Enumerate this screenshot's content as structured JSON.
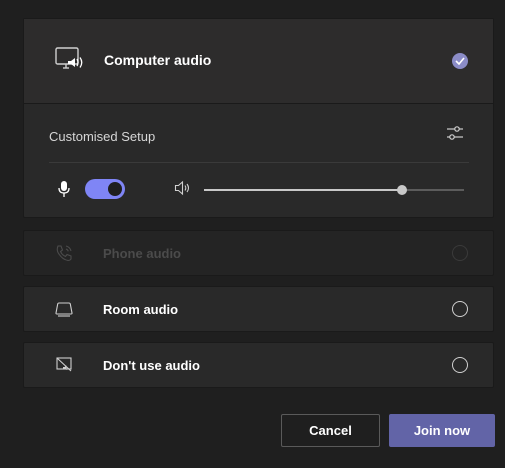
{
  "computer_audio": {
    "label": "Computer audio",
    "selected": true,
    "icon": "computer-speaker-icon"
  },
  "setup": {
    "label": "Customised Setup",
    "settings_icon": "sliders-icon"
  },
  "controls": {
    "mic_icon": "microphone-icon",
    "mic_on": true,
    "speaker_icon": "speaker-icon",
    "volume_fraction": 0.76
  },
  "options": [
    {
      "label": "Phone audio",
      "icon": "phone-icon",
      "disabled": true
    },
    {
      "label": "Room audio",
      "icon": "room-device-icon",
      "disabled": false
    },
    {
      "label": "Don't use audio",
      "icon": "no-audio-icon",
      "disabled": false
    }
  ],
  "buttons": {
    "cancel": "Cancel",
    "join": "Join now"
  },
  "colors": {
    "accent": "#6264a7",
    "toggle": "#7f85f5",
    "check": "#8b8cc7",
    "background": "#1f1f1f",
    "card": "#292929"
  }
}
